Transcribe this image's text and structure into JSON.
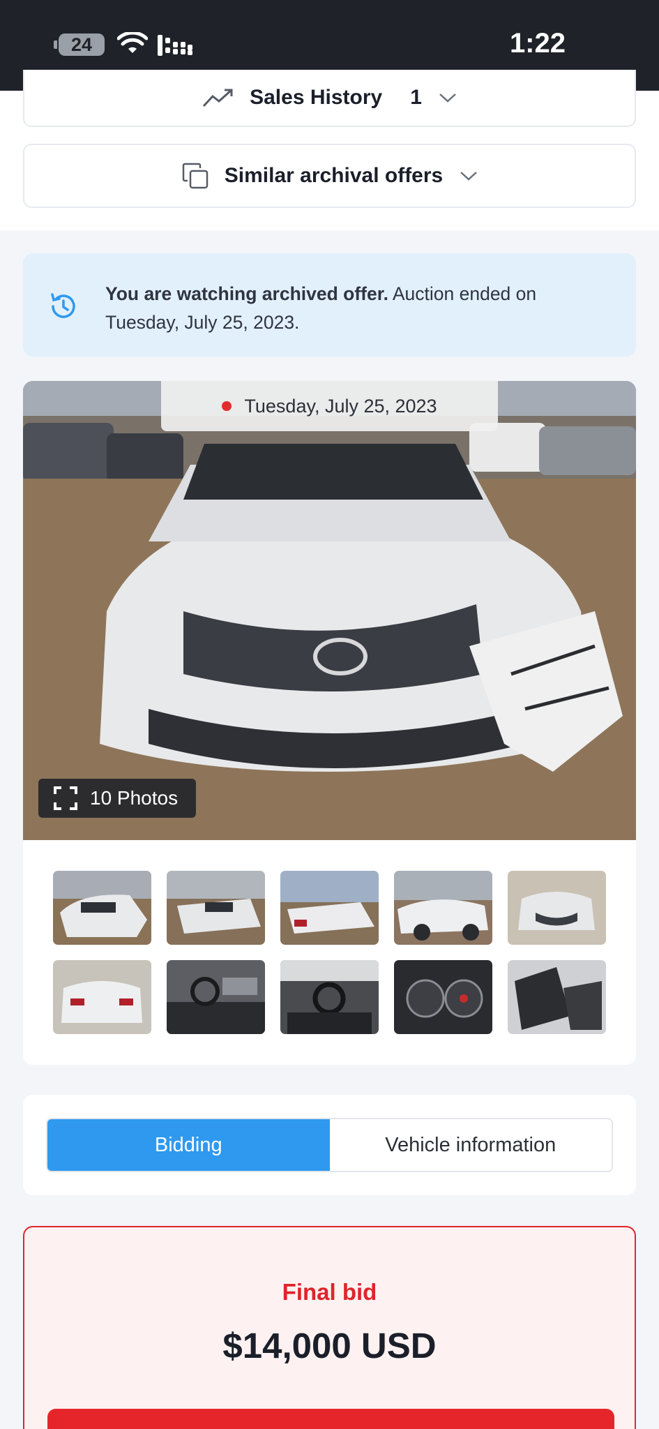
{
  "status_bar": {
    "battery": "24",
    "time": "1:22"
  },
  "sales_history": {
    "label": "Sales History",
    "count": "1"
  },
  "similar_offers": {
    "label": "Similar archival offers"
  },
  "notice": {
    "bold": "You are watching archived offer.",
    "text": " Auction ended on Tuesday, July 25, 2023."
  },
  "gallery": {
    "date": "Tuesday, July 25, 2023",
    "photos_label": "10 Photos"
  },
  "tabs": [
    {
      "label": "Bidding",
      "active": true
    },
    {
      "label": "Vehicle information",
      "active": false
    }
  ],
  "final_bid": {
    "label": "Final bid",
    "value": "$14,000 USD"
  },
  "colors": {
    "accent": "#2f99ef",
    "danger": "#e0232a",
    "notice_bg": "#e2f0fc"
  }
}
